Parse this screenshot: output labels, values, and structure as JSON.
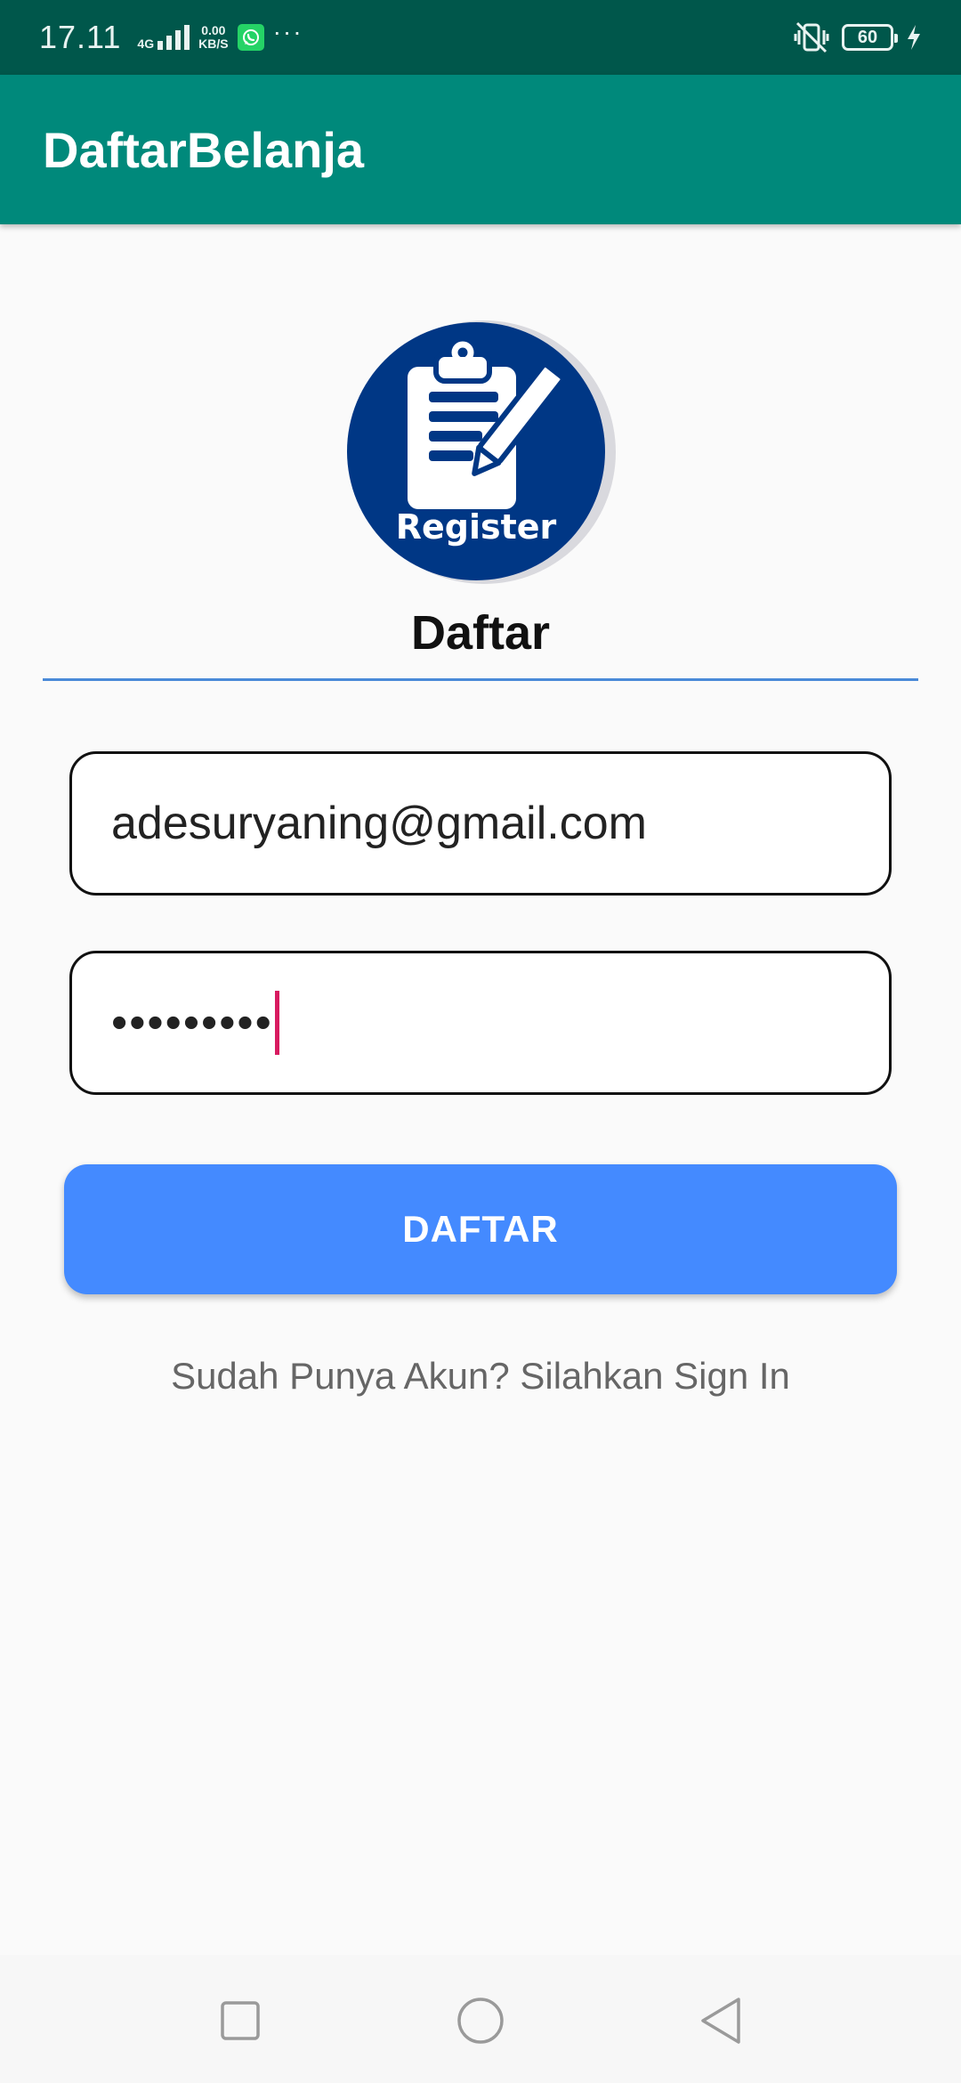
{
  "status_bar": {
    "time": "17.11",
    "network_type": "4G",
    "speed_value": "0.00",
    "speed_unit": "KB/S",
    "more": "···",
    "battery": "60",
    "icons": [
      "signal-icon",
      "whatsapp-icon",
      "vibrate-icon",
      "battery-icon",
      "charging-icon"
    ]
  },
  "app_bar": {
    "title": "DaftarBelanja"
  },
  "logo": {
    "text": "Register",
    "color": "#003785"
  },
  "form": {
    "heading": "Daftar",
    "email_value": "adesuryaning@gmail.com",
    "password_mask": "•••••••••",
    "submit_label": "DAFTAR",
    "signin_text": "Sudah Punya Akun? Silahkan Sign In"
  },
  "nav_bar": {
    "icons": [
      "recents-icon",
      "home-icon",
      "back-icon"
    ]
  },
  "colors": {
    "status_bar": "#00574b",
    "app_bar": "#00897b",
    "button": "#448aff",
    "caret": "#d81b60",
    "divider": "#4a8ad8"
  }
}
